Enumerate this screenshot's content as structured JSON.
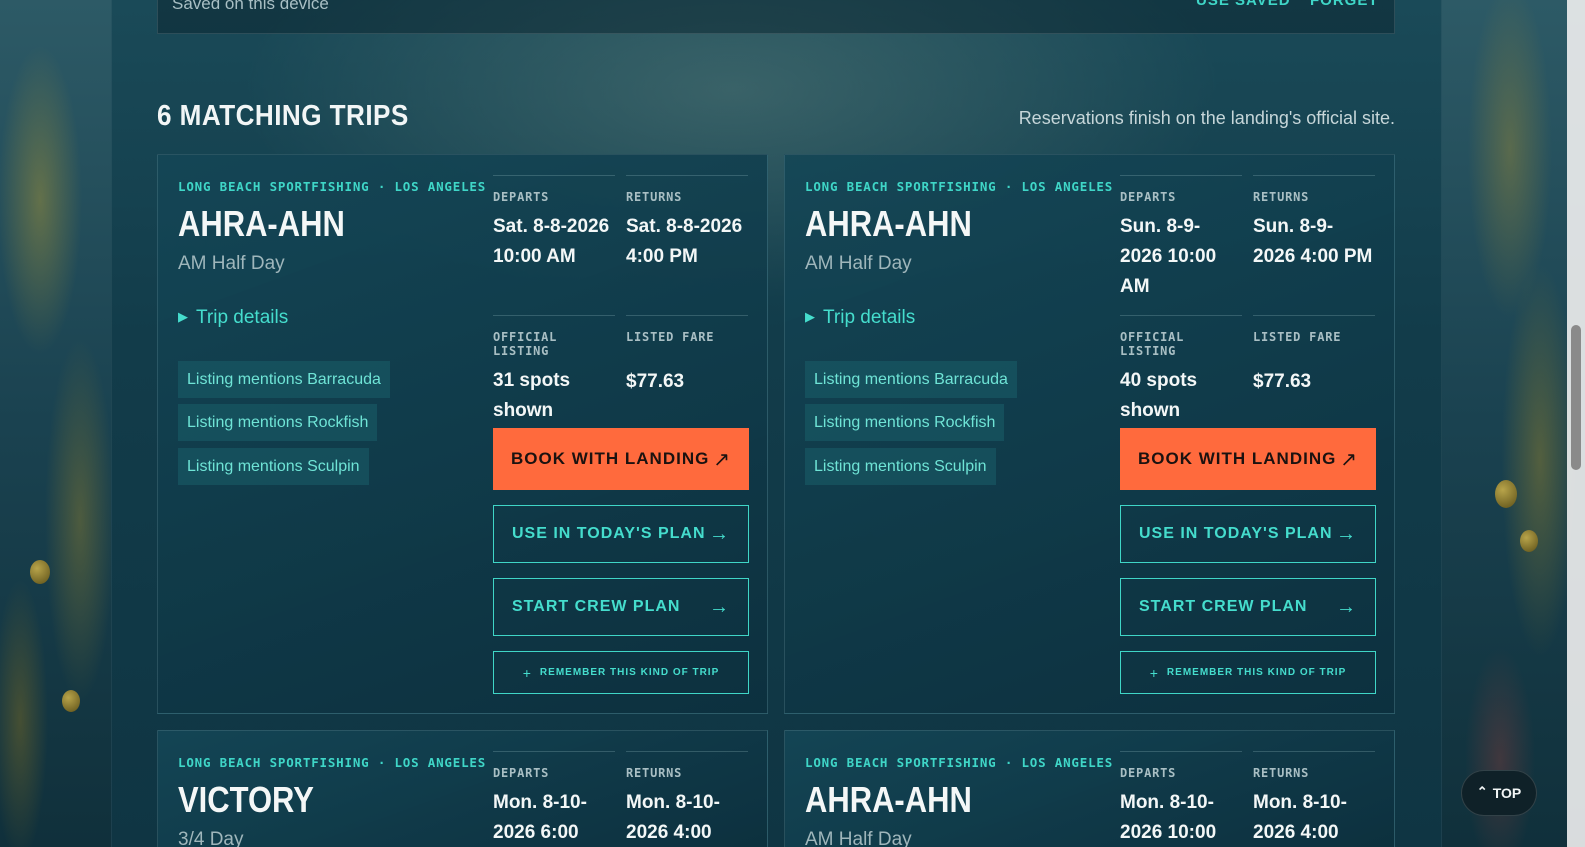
{
  "saved_bar": {
    "text": "Saved on this device",
    "use_saved": "USE SAVED",
    "forget": "FORGET"
  },
  "results": {
    "title": "6 MATCHING TRIPS",
    "note": "Reservations finish on the landing's official site."
  },
  "labels": {
    "departs": "DEPARTS",
    "returns": "RETURNS",
    "official_listing": "OFFICIAL LISTING",
    "listed_fare": "LISTED FARE",
    "trip_details": "Trip details",
    "book": "BOOK WITH LANDING",
    "use_today": "USE IN TODAY'S PLAN",
    "crew_plan": "START CREW PLAN",
    "remember": "REMEMBER THIS KIND OF TRIP"
  },
  "trips": [
    {
      "landing": "LONG BEACH SPORTFISHING · LOS ANGELES",
      "boat": "AHRA-AHN",
      "type": "AM Half Day",
      "departs": "Sat. 8-8-2026 10:00 AM",
      "returns": "Sat. 8-8-2026 4:00 PM",
      "spots": "31 spots shown",
      "fare": "$77.63",
      "chips": [
        "Listing mentions Barracuda",
        "Listing mentions Rockfish",
        "Listing mentions Sculpin"
      ]
    },
    {
      "landing": "LONG BEACH SPORTFISHING · LOS ANGELES",
      "boat": "AHRA-AHN",
      "type": "AM Half Day",
      "departs": "Sun. 8-9-2026 10:00 AM",
      "returns": "Sun. 8-9-2026 4:00 PM",
      "spots": "40 spots shown",
      "fare": "$77.63",
      "chips": [
        "Listing mentions Barracuda",
        "Listing mentions Rockfish",
        "Listing mentions Sculpin"
      ]
    },
    {
      "landing": "LONG BEACH SPORTFISHING · LOS ANGELES",
      "boat": "VICTORY",
      "type": "3/4 Day",
      "departs": "Mon. 8-10-2026 6:00",
      "returns": "Mon. 8-10-2026 4:00"
    },
    {
      "landing": "LONG BEACH SPORTFISHING · LOS ANGELES",
      "boat": "AHRA-AHN",
      "type": "AM Half Day",
      "departs": "Mon. 8-10-2026 10:00",
      "returns": "Mon. 8-10-2026 4:00"
    }
  ],
  "top_button": "TOP"
}
